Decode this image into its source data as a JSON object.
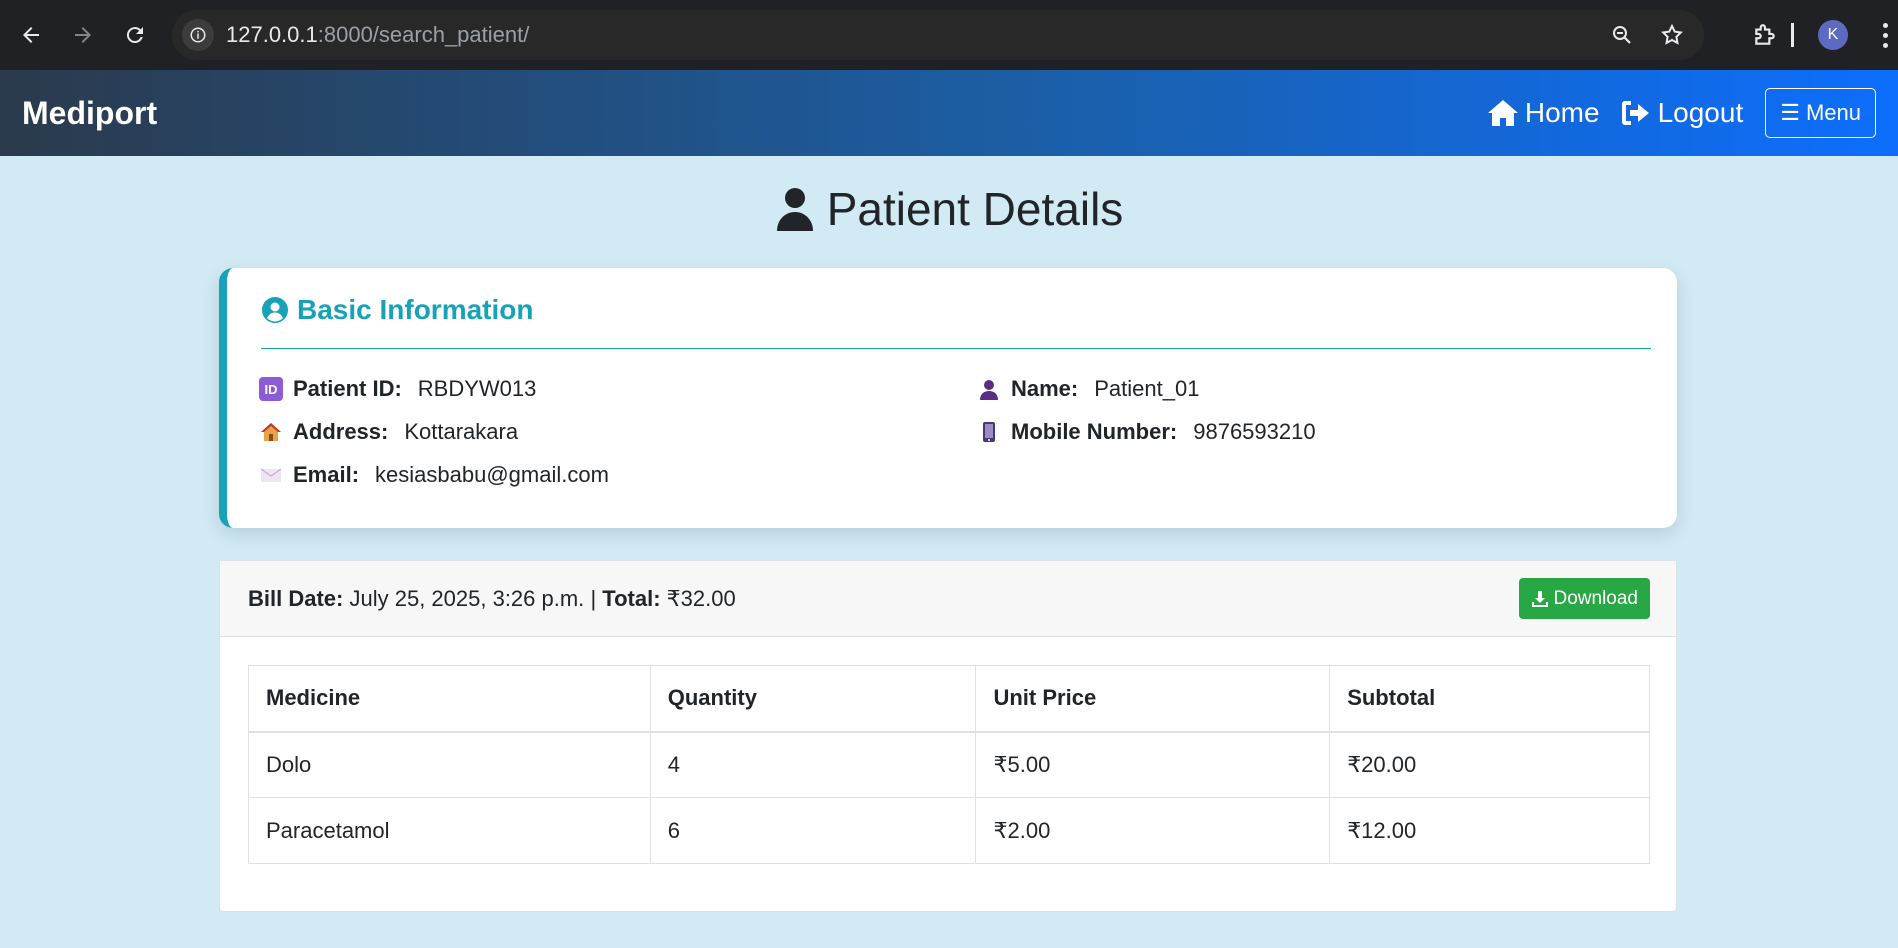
{
  "browser": {
    "url_host": "127.0.0.1",
    "url_rest": ":8000/search_patient/",
    "profile_initial": "K"
  },
  "navbar": {
    "brand": "Mediport",
    "home": "Home",
    "logout": "Logout",
    "menu": "Menu"
  },
  "page": {
    "title": "Patient Details"
  },
  "basic_info": {
    "heading": "Basic Information",
    "patient_id_label": "Patient ID:",
    "patient_id": "RBDYW013",
    "name_label": "Name:",
    "name": "Patient_01",
    "address_label": "Address:",
    "address": "Kottarakara",
    "mobile_label": "Mobile Number:",
    "mobile": "9876593210",
    "email_label": "Email:",
    "email": "kesiasbabu@gmail.com"
  },
  "bill": {
    "date_label": "Bill Date:",
    "date": "July 25, 2025, 3:26 p.m.",
    "separator": "|",
    "total_label": "Total:",
    "total": "₹32.00",
    "download": "Download",
    "columns": [
      "Medicine",
      "Quantity",
      "Unit Price",
      "Subtotal"
    ],
    "rows": [
      [
        "Dolo",
        "4",
        "₹5.00",
        "₹20.00"
      ],
      [
        "Paracetamol",
        "6",
        "₹2.00",
        "₹12.00"
      ]
    ]
  },
  "colors": {
    "accent": "#17a2b8",
    "success": "#28a745",
    "page_bg": "#d1eaf4"
  }
}
